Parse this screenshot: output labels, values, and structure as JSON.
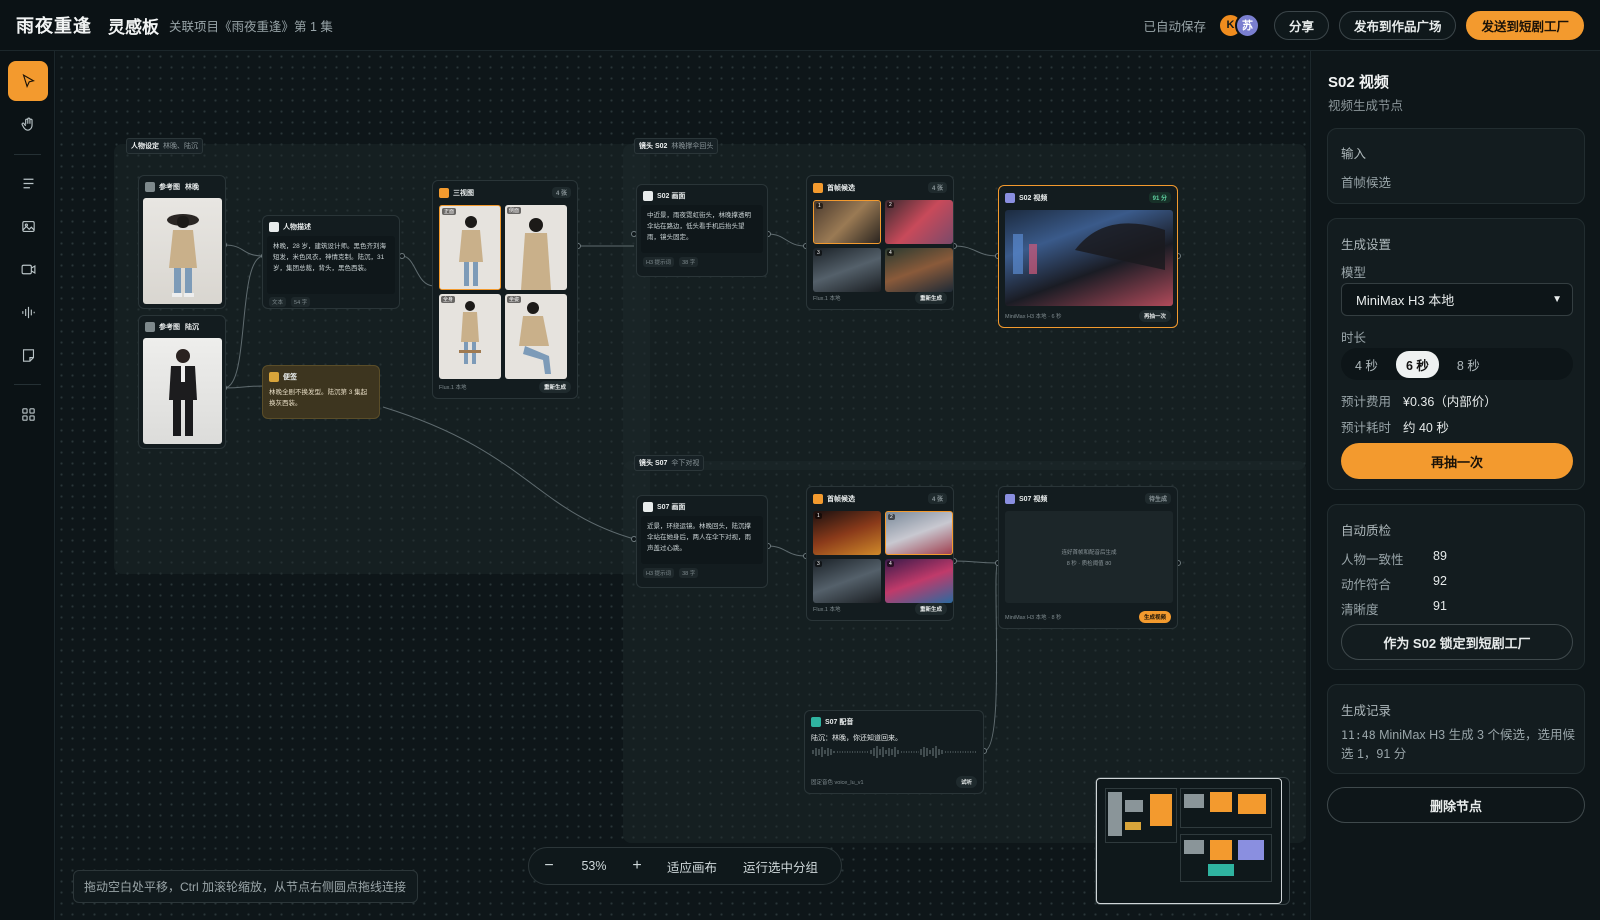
{
  "topbar": {
    "brand": "雨夜重逢",
    "board": "灵感板",
    "project": "关联项目《雨夜重逢》第 1 集",
    "autosave": "已自动保存",
    "avatars": [
      "K",
      "苏"
    ],
    "share": "分享",
    "publish": "发布到作品广场",
    "send": "发送到短剧工厂"
  },
  "tools": [
    "pointer-icon",
    "hand-icon",
    "text-icon",
    "image-icon",
    "video-icon",
    "audio-icon",
    "note-icon",
    "grid-icon"
  ],
  "groups": {
    "characters": {
      "title": "人物设定",
      "sub": "林晚、陆沉"
    },
    "shot2": {
      "title": "镜头 S02",
      "sub": "林晚撑伞回头"
    },
    "shot7": {
      "title": "镜头 S07",
      "sub": "伞下对视"
    }
  },
  "nodes": {
    "ref1": {
      "title": "参考图",
      "name": "林晚"
    },
    "ref2": {
      "title": "参考图",
      "name": "陆沉"
    },
    "desc": {
      "title": "人物描述",
      "text": "林晚，28 岁，建筑设计师。黑色齐刘海短发，米色风衣，神情克制。陆沉，31 岁，集团总裁，背头，黑色西装。",
      "tags": [
        "文本",
        "54 字"
      ]
    },
    "note": {
      "title": "便签",
      "text": "林晚全剧不换发型。陆沉第 3 集起换灰西装。"
    },
    "three": {
      "title": "三视图",
      "count": "4 张",
      "labels": [
        "正面",
        "侧面",
        "全身",
        "坐姿"
      ],
      "model": "Flux.1 本地",
      "btn": "重新生成"
    },
    "s02img": {
      "title": "S02 画面",
      "text": "中近景，雨夜霓虹街头，林晚撑透明伞站在路边，低头看手机后抬头望雨，镜头固定。",
      "tags": [
        "H3 提示词",
        "38 字"
      ]
    },
    "first2": {
      "title": "首帧候选",
      "count": "4 张",
      "nums": [
        "1",
        "2",
        "3",
        "4"
      ],
      "model": "Flux.1 本地",
      "btn": "重新生成"
    },
    "s02vid": {
      "title": "S02 视频",
      "badge": "91 分",
      "model": "MiniMax H3 本地 · 6 秒",
      "btn": "再抽一次"
    },
    "s07img": {
      "title": "S07 画面",
      "text": "近景，环绕运镜。林晚回头，陆沉撑伞站在她身后，两人在伞下对视，雨声盖过心跳。",
      "tags": [
        "H3 提示词",
        "38 字"
      ]
    },
    "first7": {
      "title": "首帧候选",
      "count": "4 张",
      "nums": [
        "1",
        "2",
        "3",
        "4"
      ],
      "model": "Flux.1 本地",
      "btn": "重新生成"
    },
    "s07vid": {
      "title": "S07 视频",
      "badge": "待生成",
      "center": "连好首帧和配音后生成",
      "center2": "8 秒 · 质检阈值 80",
      "model": "MiniMax H3 本地 · 8 秒",
      "btn": "生成视频"
    },
    "voice": {
      "title": "S07 配音",
      "line": "陆沉：林晚，你还知道回来。",
      "model": "固定音色 voice_lu_v1",
      "btn": "试听"
    }
  },
  "zoom": {
    "minus": "−",
    "level": "53%",
    "plus": "+",
    "fit": "适应画布",
    "run": "运行选中分组"
  },
  "hint": "拖动空白处平移，Ctrl 加滚轮缩放，从节点右侧圆点拖线连接",
  "panel": {
    "title": "S02 视频",
    "subtitle": "视频生成节点",
    "input_label": "输入",
    "input_value": "首帧候选",
    "settings_label": "生成设置",
    "model_label": "模型",
    "model_value": "MiniMax H3 本地",
    "duration_label": "时长",
    "durations": [
      "4 秒",
      "6 秒",
      "8 秒"
    ],
    "selected_duration": "6 秒",
    "cost_label": "预计费用",
    "cost_value": "¥0.36（内部价）",
    "time_label": "预计耗时",
    "time_value": "约 40 秒",
    "reroll": "再抽一次",
    "qc_label": "自动质检",
    "qc": [
      {
        "label": "人物一致性",
        "value": "89"
      },
      {
        "label": "动作符合",
        "value": "92"
      },
      {
        "label": "清晰度",
        "value": "91"
      }
    ],
    "lock": "作为 S02 锁定到短剧工厂",
    "history_label": "生成记录",
    "history_time": "11:48",
    "history_text": "MiniMax H3 生成 3 个候选，选用候选 1，91 分",
    "delete": "删除节点"
  },
  "colors": {
    "accent": "#f39a2e",
    "video": "#8a8fe0",
    "voice": "#2fb3a0",
    "note": "#d9a53a"
  }
}
